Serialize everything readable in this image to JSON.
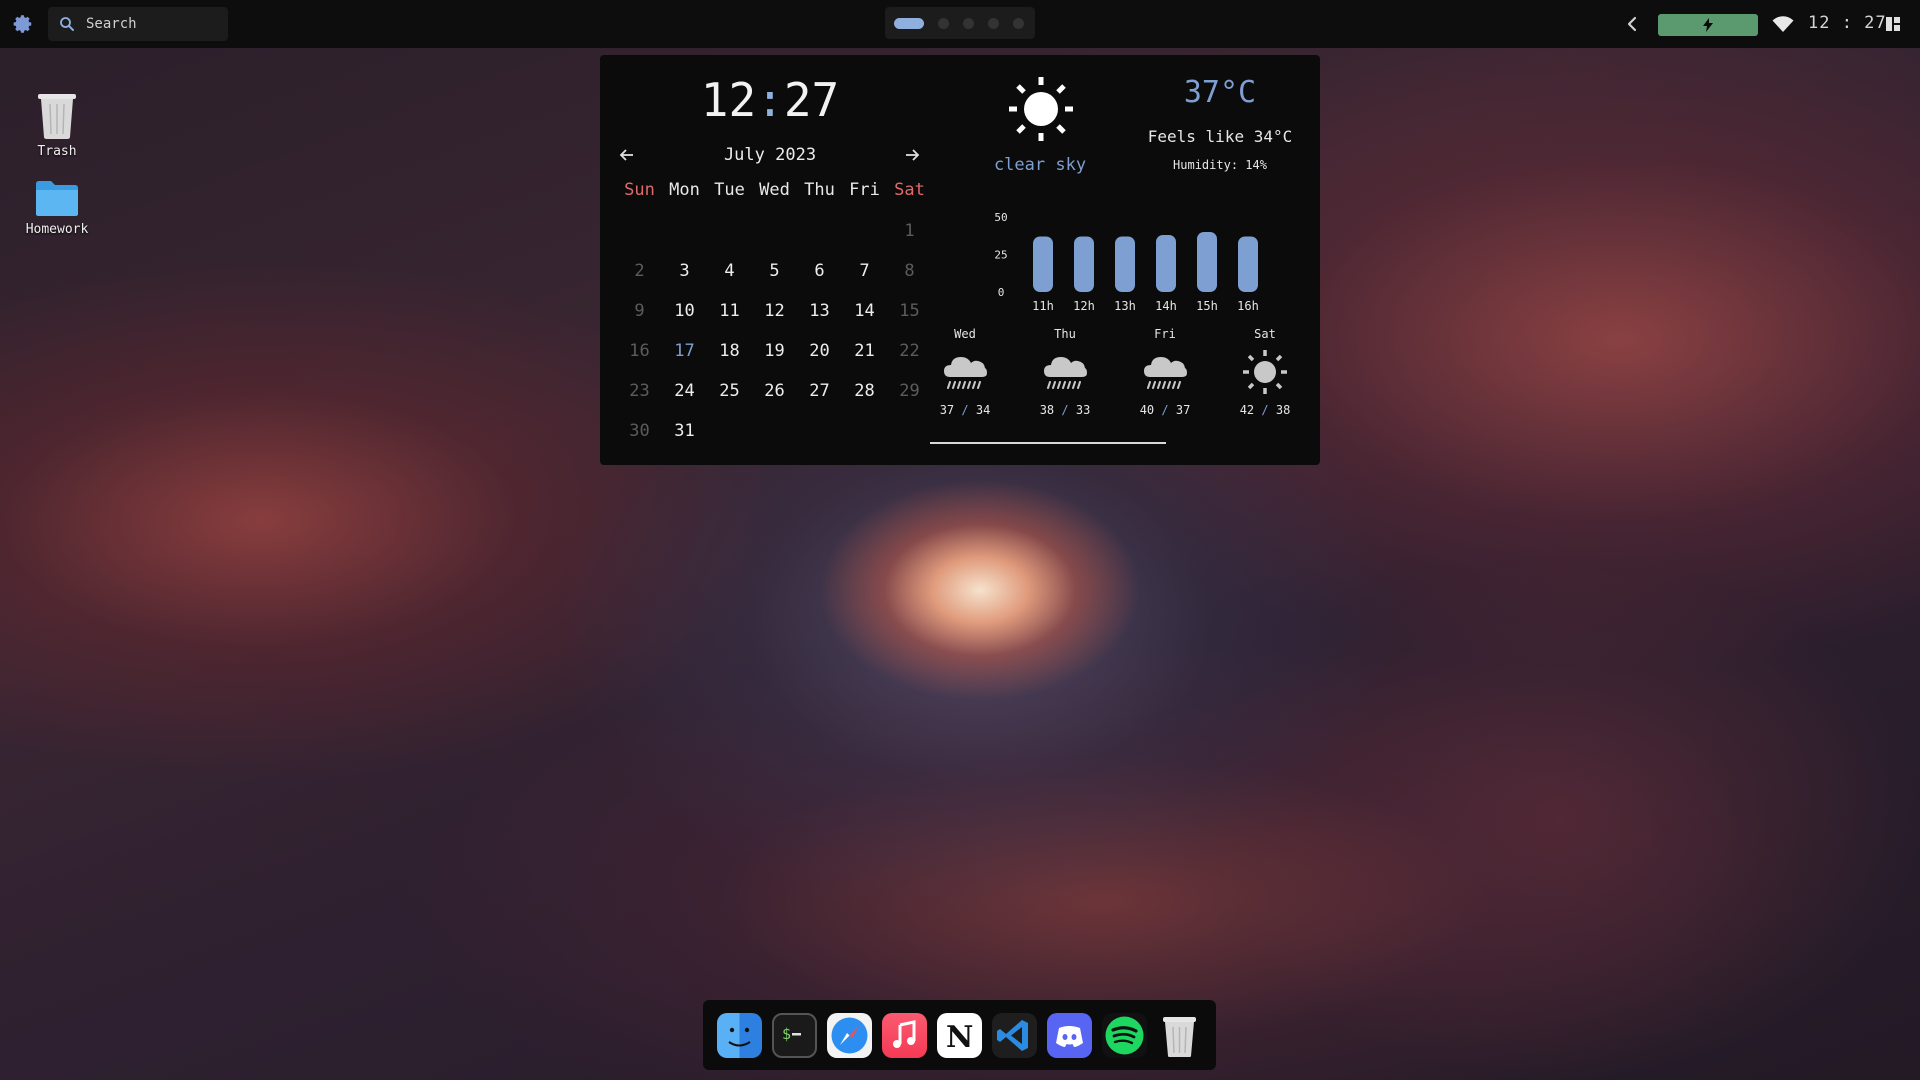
{
  "topbar": {
    "search_placeholder": "Search",
    "clock": "12 : 27",
    "battery_icon": "lightning-bolt",
    "battery_color": "#5a9a6e",
    "workspaces": [
      {
        "active": true
      },
      {
        "active": false
      },
      {
        "active": false
      },
      {
        "active": false
      },
      {
        "active": false
      }
    ]
  },
  "desktop": {
    "icons": [
      {
        "label": "Trash",
        "icon": "trash-icon"
      },
      {
        "label": "Homework",
        "icon": "folder-icon"
      }
    ]
  },
  "widget": {
    "clock": {
      "hours": "12",
      "sep": ":",
      "minutes": "27"
    },
    "calendar": {
      "month_label": "July 2023",
      "weekdays": [
        "Sun",
        "Mon",
        "Tue",
        "Wed",
        "Thu",
        "Fri",
        "Sat"
      ],
      "weeks": [
        [
          "",
          "",
          "",
          "",
          "",
          "",
          "1"
        ],
        [
          "2",
          "3",
          "4",
          "5",
          "6",
          "7",
          "8"
        ],
        [
          "9",
          "10",
          "11",
          "12",
          "13",
          "14",
          "15"
        ],
        [
          "16",
          "17",
          "18",
          "19",
          "20",
          "21",
          "22"
        ],
        [
          "23",
          "24",
          "25",
          "26",
          "27",
          "28",
          "29"
        ],
        [
          "30",
          "31",
          "",
          "",
          "",
          "",
          ""
        ]
      ],
      "today": "17"
    },
    "weather": {
      "condition": "clear sky",
      "temperature": "37°C",
      "feels_like": "Feels like 34°C",
      "humidity": "Humidity: 14%",
      "accent_color": "#7e9fd2"
    },
    "forecast": [
      {
        "day": "Wed",
        "icon": "rain-cloud-icon",
        "high": "37",
        "low": "34"
      },
      {
        "day": "Thu",
        "icon": "rain-cloud-icon",
        "high": "38",
        "low": "33"
      },
      {
        "day": "Fri",
        "icon": "rain-cloud-icon",
        "high": "40",
        "low": "37"
      },
      {
        "day": "Sat",
        "icon": "sun-icon",
        "high": "42",
        "low": "38"
      }
    ]
  },
  "chart_data": {
    "type": "bar",
    "categories": [
      "11h",
      "12h",
      "13h",
      "14h",
      "15h",
      "16h"
    ],
    "values": [
      37,
      37,
      37,
      38,
      40,
      37
    ],
    "yticks": [
      "50",
      "25",
      "0"
    ],
    "ylim": [
      0,
      50
    ],
    "color": "#7e9fd2"
  },
  "dock": {
    "apps": [
      "finder-icon",
      "terminal-icon",
      "safari-icon",
      "music-icon",
      "notion-icon",
      "vscode-icon",
      "discord-icon",
      "spotify-icon",
      "trash-icon"
    ]
  }
}
